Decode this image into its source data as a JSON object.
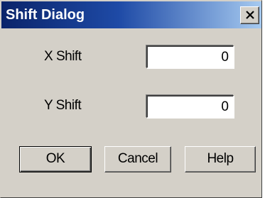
{
  "window": {
    "title": "Shift Dialog",
    "close_icon": "close-icon"
  },
  "fields": {
    "x_shift": {
      "label": "X Shift",
      "value": "0"
    },
    "y_shift": {
      "label": "Y Shift",
      "value": "0"
    }
  },
  "buttons": {
    "ok": "OK",
    "cancel": "Cancel",
    "help": "Help"
  },
  "colors": {
    "title_bar_start": "#0a246a",
    "title_bar_end": "#a6caf0",
    "dialog_face": "#d4d0c8"
  }
}
